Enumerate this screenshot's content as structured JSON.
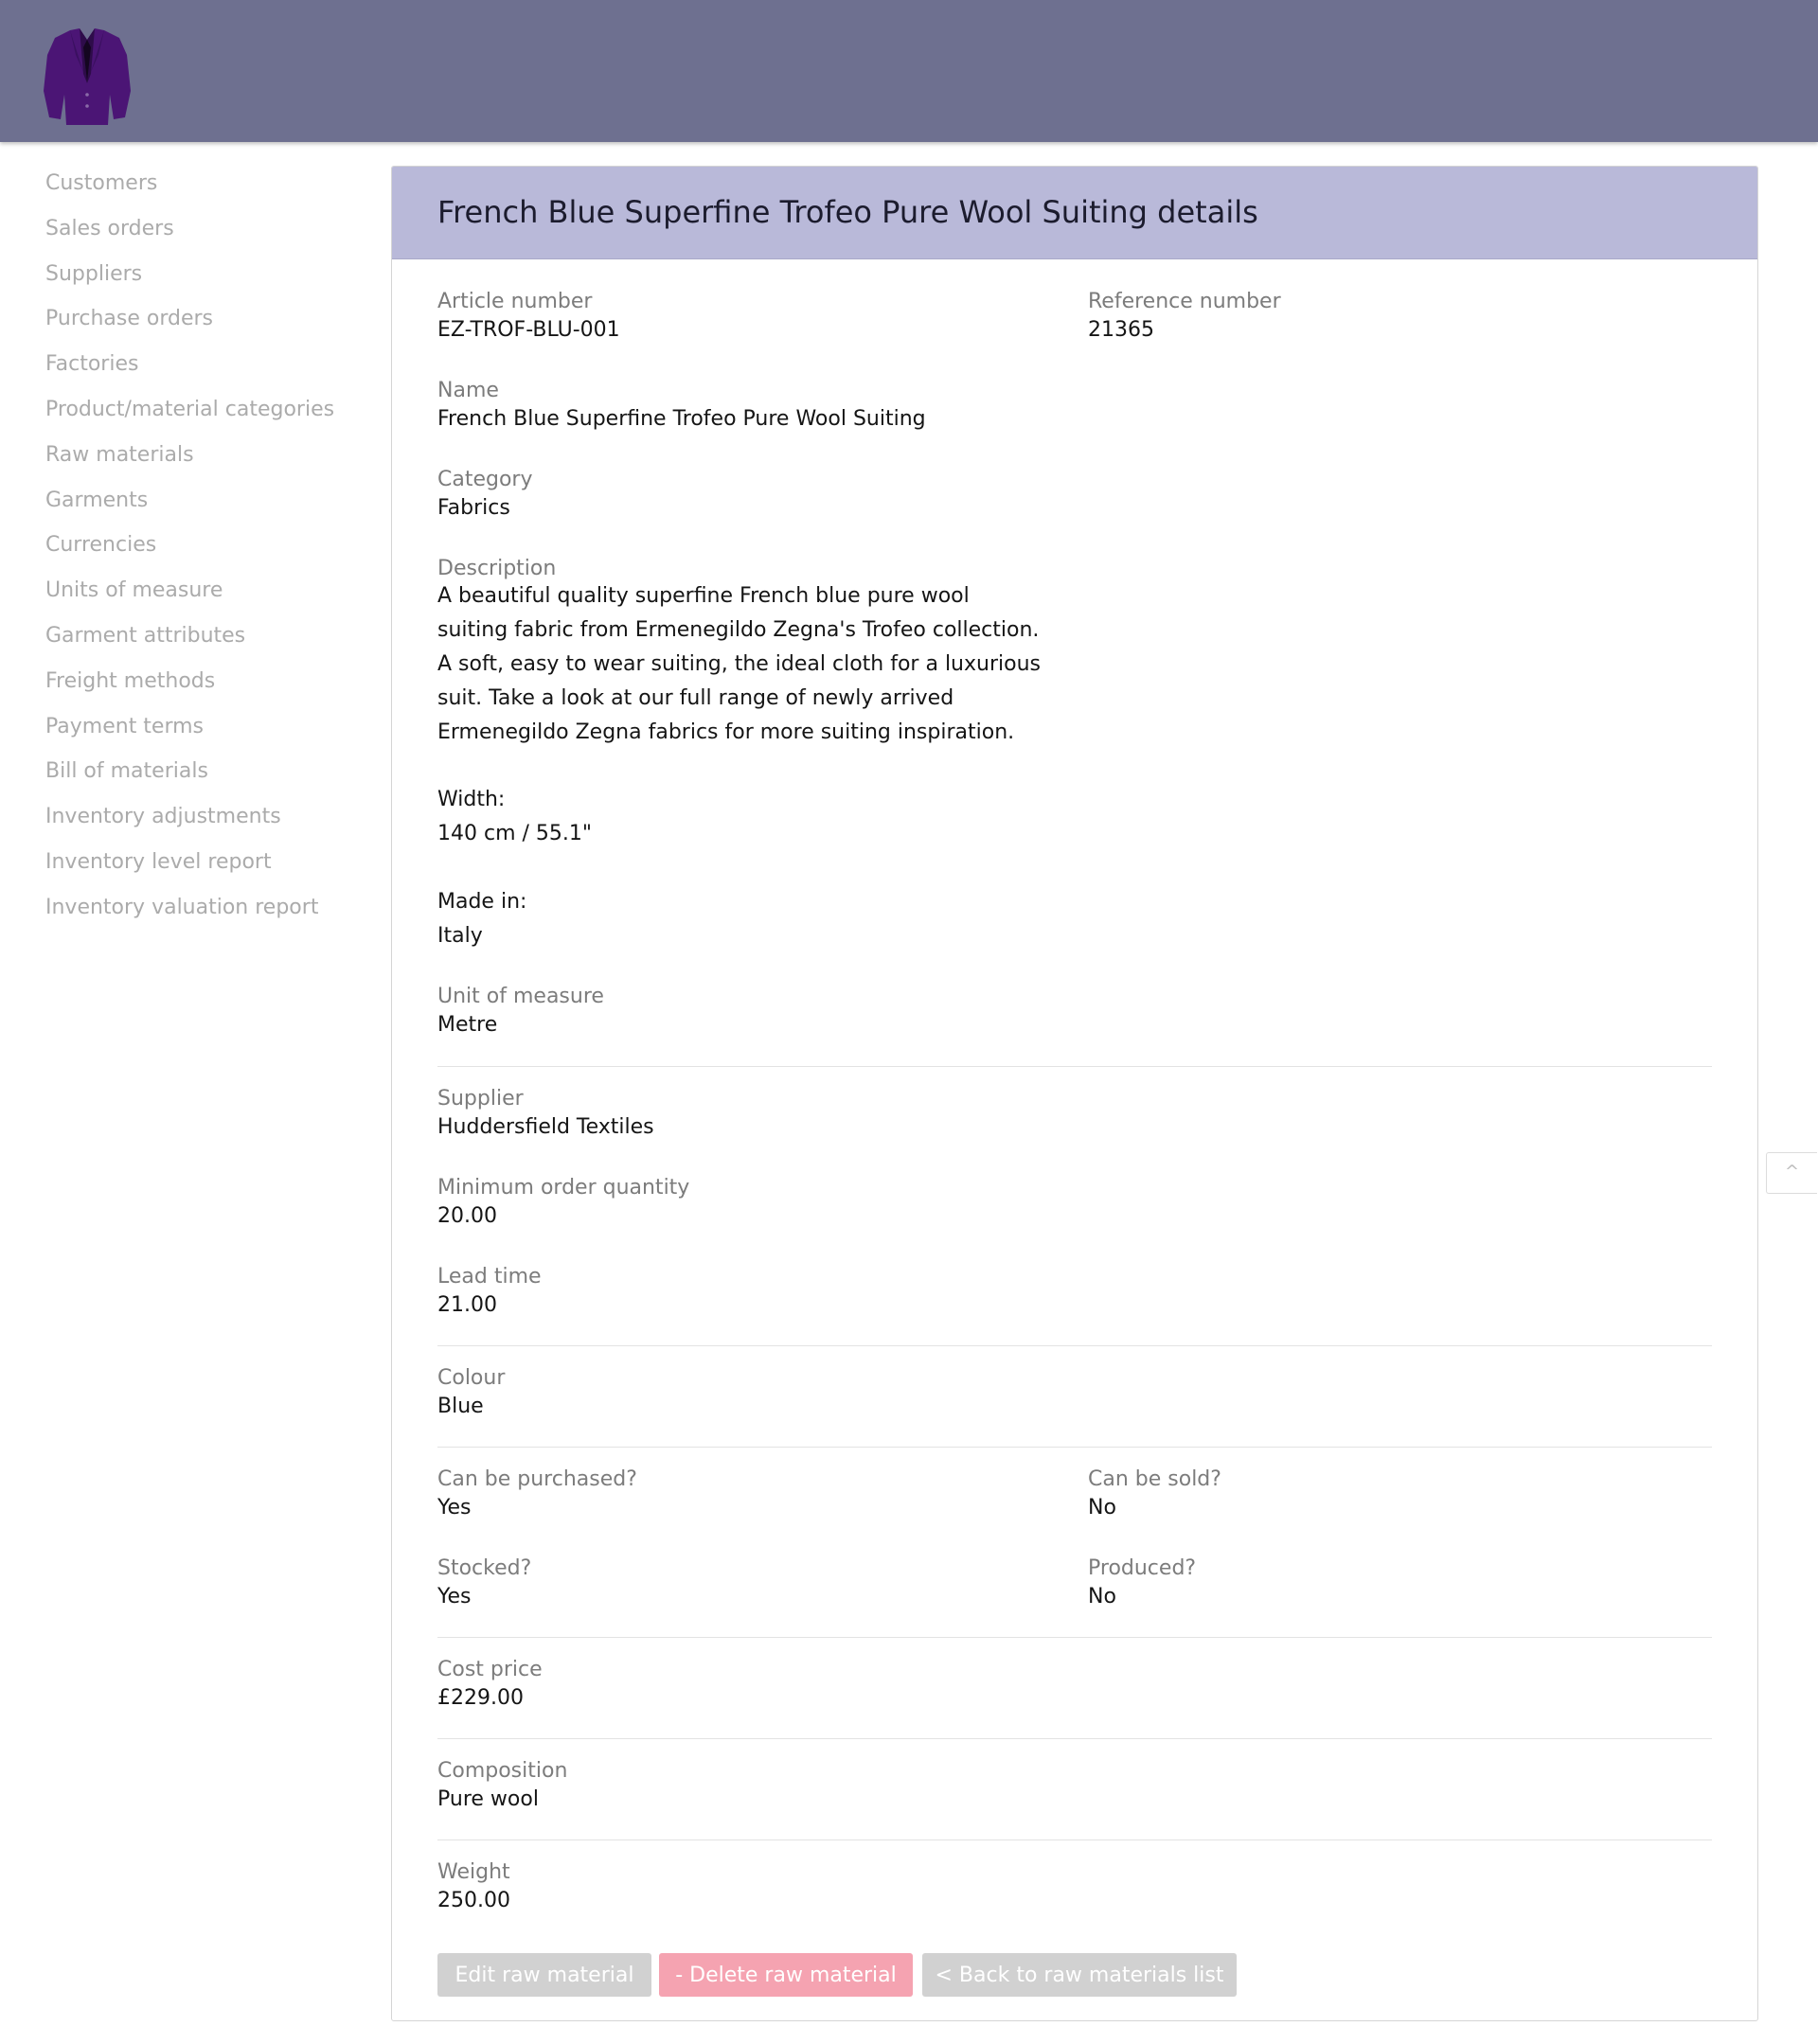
{
  "header": {
    "logo_icon": "suit-jacket-icon"
  },
  "sidebar": {
    "items": [
      {
        "label": "Customers"
      },
      {
        "label": "Sales orders"
      },
      {
        "label": "Suppliers"
      },
      {
        "label": "Purchase orders"
      },
      {
        "label": "Factories"
      },
      {
        "label": "Product/material categories"
      },
      {
        "label": "Raw materials"
      },
      {
        "label": "Garments"
      },
      {
        "label": "Currencies"
      },
      {
        "label": "Units of measure"
      },
      {
        "label": "Garment attributes"
      },
      {
        "label": "Freight methods"
      },
      {
        "label": "Payment terms"
      },
      {
        "label": "Bill of materials"
      },
      {
        "label": "Inventory adjustments"
      },
      {
        "label": "Inventory level report"
      },
      {
        "label": "Inventory valuation report"
      }
    ]
  },
  "panel": {
    "title": "French Blue Superfine Trofeo Pure Wool Suiting details",
    "article_number": {
      "label": "Article number",
      "value": "EZ-TROF-BLU-001"
    },
    "reference_number": {
      "label": "Reference number",
      "value": "21365"
    },
    "name": {
      "label": "Name",
      "value": "French Blue Superfine Trofeo Pure Wool Suiting"
    },
    "category": {
      "label": "Category",
      "value": "Fabrics"
    },
    "description": {
      "label": "Description",
      "value": "A beautiful quality superfine French blue pure wool suiting fabric from Ermenegildo Zegna's Trofeo collection. A soft, easy to wear suiting, the ideal cloth for a luxurious suit. Take a look at our full range of newly arrived Ermenegildo Zegna fabrics for more suiting inspiration."
    },
    "width": {
      "label": "Width:",
      "value": "140 cm / 55.1\""
    },
    "made_in": {
      "label": "Made in:",
      "value": "Italy"
    },
    "unit_of_measure": {
      "label": "Unit of measure",
      "value": "Metre"
    },
    "supplier": {
      "label": "Supplier",
      "value": "Huddersfield Textiles"
    },
    "minimum_order_quantity": {
      "label": "Minimum order quantity",
      "value": "20.00"
    },
    "lead_time": {
      "label": "Lead time",
      "value": "21.00"
    },
    "colour": {
      "label": "Colour",
      "value": "Blue"
    },
    "can_be_purchased": {
      "label": "Can be purchased?",
      "value": "Yes"
    },
    "can_be_sold": {
      "label": "Can be sold?",
      "value": "No"
    },
    "stocked": {
      "label": "Stocked?",
      "value": "Yes"
    },
    "produced": {
      "label": "Produced?",
      "value": "No"
    },
    "cost_price": {
      "label": "Cost price",
      "value": "£229.00"
    },
    "composition": {
      "label": "Composition",
      "value": "Pure wool"
    },
    "weight": {
      "label": "Weight",
      "value": "250.00"
    }
  },
  "actions": {
    "edit_label": "Edit raw material",
    "delete_label": "- Delete raw material",
    "back_label": "< Back to raw materials list"
  },
  "scroll_top": {
    "label": "^"
  },
  "colors": {
    "header_bg": "#6e7090",
    "panel_head_bg": "#b9b9d9",
    "delete_button": "#f5a3b1",
    "neutral_button": "#d1d1d1",
    "logo": "#4b1575"
  }
}
